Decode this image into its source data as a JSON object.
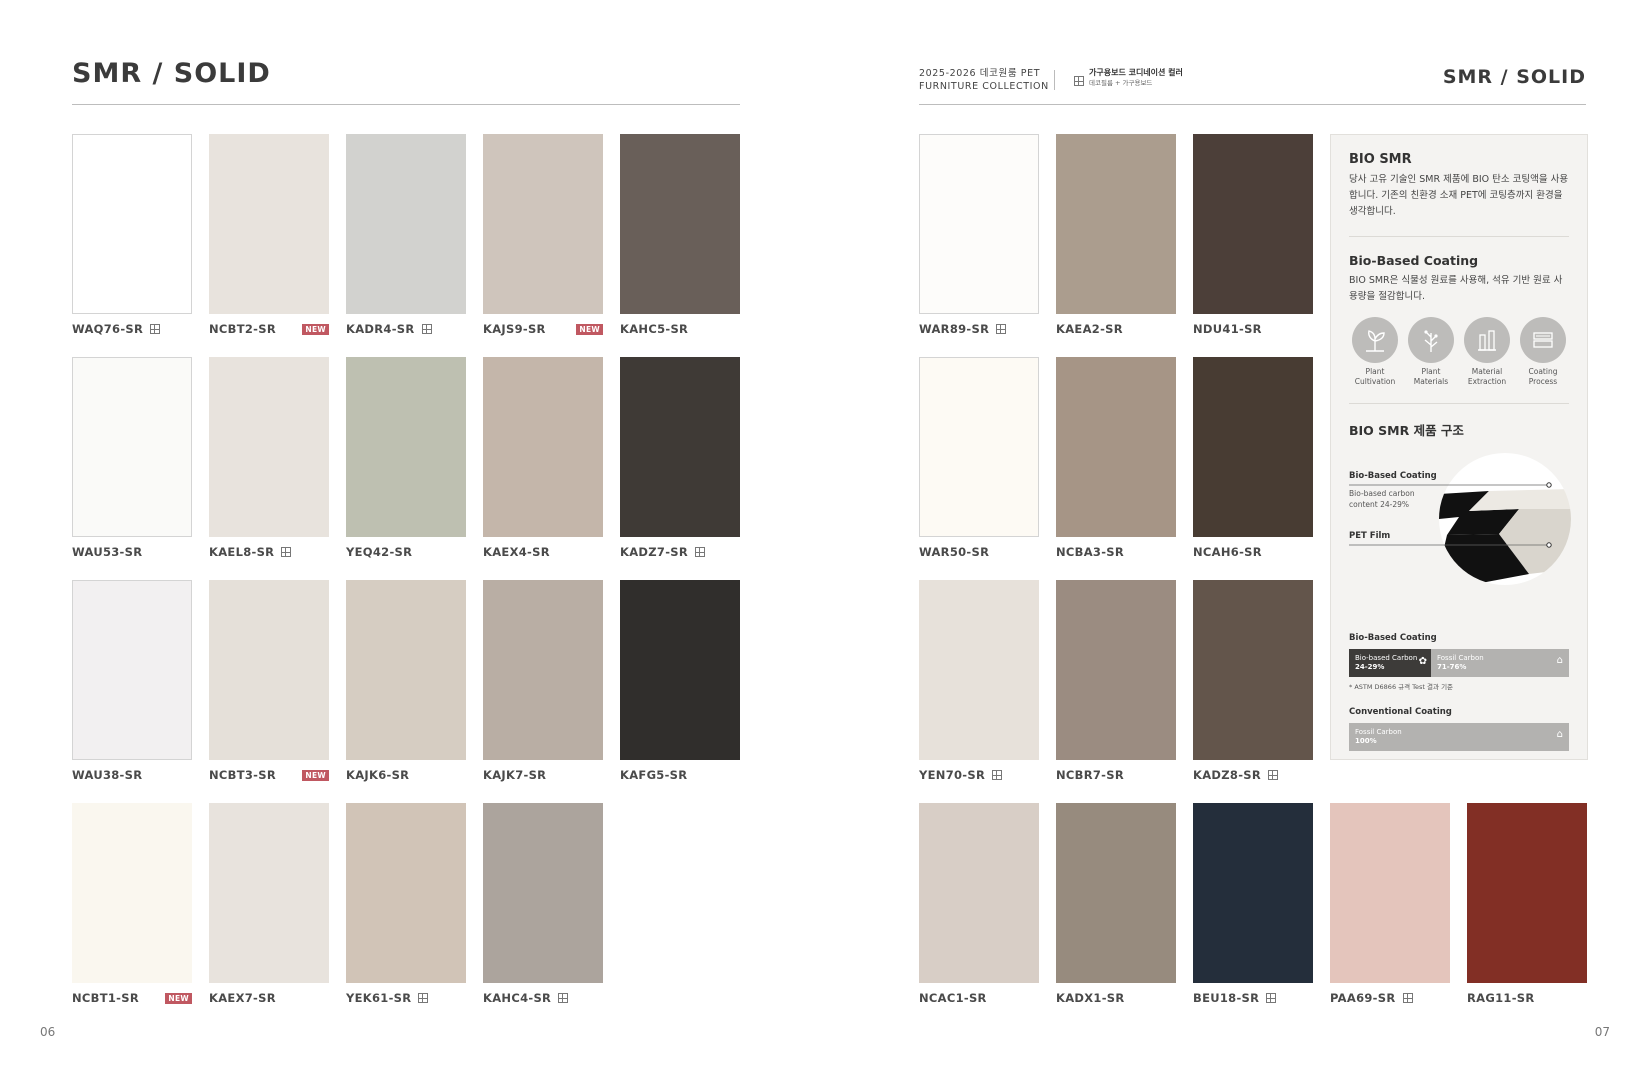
{
  "left_page": {
    "title": "SMR / SOLID",
    "page_number": "06",
    "rows": [
      [
        {
          "code": "WAQ76-SR",
          "color": "#ffffff",
          "bordered": true,
          "grid": true,
          "new": false
        },
        {
          "code": "NCBT2-SR",
          "color": "#e8e3dd",
          "bordered": false,
          "grid": false,
          "new": true
        },
        {
          "code": "KADR4-SR",
          "color": "#d2d2cf",
          "bordered": false,
          "grid": true,
          "new": false
        },
        {
          "code": "KAJS9-SR",
          "color": "#cfc5bc",
          "bordered": false,
          "grid": false,
          "new": true
        },
        {
          "code": "KAHC5-SR",
          "color": "#695f59",
          "bordered": false,
          "grid": false,
          "new": false
        }
      ],
      [
        {
          "code": "WAU53-SR",
          "color": "#fafaf8",
          "bordered": true,
          "grid": false,
          "new": false
        },
        {
          "code": "KAEL8-SR",
          "color": "#e8e3dd",
          "bordered": false,
          "grid": true,
          "new": false
        },
        {
          "code": "YEQ42-SR",
          "color": "#bec0b1",
          "bordered": false,
          "grid": false,
          "new": false
        },
        {
          "code": "KAEX4-SR",
          "color": "#c4b6aa",
          "bordered": false,
          "grid": false,
          "new": false
        },
        {
          "code": "KADZ7-SR",
          "color": "#3f3a36",
          "bordered": false,
          "grid": true,
          "new": false
        }
      ],
      [
        {
          "code": "WAU38-SR",
          "color": "#f2f0f1",
          "bordered": true,
          "grid": false,
          "new": false
        },
        {
          "code": "NCBT3-SR",
          "color": "#e5e0d9",
          "bordered": false,
          "grid": false,
          "new": true
        },
        {
          "code": "KAJK6-SR",
          "color": "#d6cdc2",
          "bordered": false,
          "grid": false,
          "new": false
        },
        {
          "code": "KAJK7-SR",
          "color": "#b9aea4",
          "bordered": false,
          "grid": false,
          "new": false
        },
        {
          "code": "KAFG5-SR",
          "color": "#302e2c",
          "bordered": false,
          "grid": false,
          "new": false
        }
      ],
      [
        {
          "code": "NCBT1-SR",
          "color": "#faf7ef",
          "bordered": false,
          "grid": false,
          "new": true
        },
        {
          "code": "KAEX7-SR",
          "color": "#e8e3dd",
          "bordered": false,
          "grid": false,
          "new": false
        },
        {
          "code": "YEK61-SR",
          "color": "#d1c4b7",
          "bordered": false,
          "grid": true,
          "new": false
        },
        {
          "code": "KAHC4-SR",
          "color": "#aca49d",
          "bordered": false,
          "grid": true,
          "new": false
        }
      ]
    ]
  },
  "right_page": {
    "title": "SMR / SOLID",
    "page_number": "07",
    "header": {
      "line1": "2025-2026 데코원룸 PET",
      "line2": "FURNITURE COLLECTION",
      "right1": "가구용보드 코디네이션 컬러",
      "right2": "데코필름 + 가구용보드"
    },
    "rows": [
      [
        {
          "code": "WAR89-SR",
          "color": "#fdfcfa",
          "bordered": true,
          "grid": true,
          "new": false
        },
        {
          "code": "KAEA2-SR",
          "color": "#ab9d8e",
          "bordered": false,
          "grid": false,
          "new": false
        },
        {
          "code": "NDU41-SR",
          "color": "#4c3f39",
          "bordered": false,
          "grid": false,
          "new": false
        }
      ],
      [
        {
          "code": "WAR50-SR",
          "color": "#fdfaf4",
          "bordered": true,
          "grid": false,
          "new": false
        },
        {
          "code": "NCBA3-SR",
          "color": "#a69586",
          "bordered": false,
          "grid": false,
          "new": false
        },
        {
          "code": "NCAH6-SR",
          "color": "#483c33",
          "bordered": false,
          "grid": false,
          "new": false
        }
      ],
      [
        {
          "code": "YEN70-SR",
          "color": "#e7e1da",
          "bordered": false,
          "grid": true,
          "new": false
        },
        {
          "code": "NCBR7-SR",
          "color": "#9b8c81",
          "bordered": false,
          "grid": false,
          "new": false
        },
        {
          "code": "KADZ8-SR",
          "color": "#63554b",
          "bordered": false,
          "grid": true,
          "new": false
        }
      ],
      [
        {
          "code": "NCAC1-SR",
          "color": "#d8cec6",
          "bordered": false,
          "grid": false,
          "new": false
        },
        {
          "code": "KADX1-SR",
          "color": "#978b7e",
          "bordered": false,
          "grid": false,
          "new": false
        },
        {
          "code": "BEU18-SR",
          "color": "#242e3b",
          "bordered": false,
          "grid": true,
          "new": false
        },
        {
          "code": "PAA69-SR",
          "color": "#e4c5bc",
          "bordered": false,
          "grid": true,
          "new": false
        },
        {
          "code": "RAG11-SR",
          "color": "#822f25",
          "bordered": false,
          "grid": false,
          "new": false
        }
      ]
    ],
    "panel": {
      "heading1": "BIO SMR",
      "text1": "당사 고유 기술인 SMR 제품에 BIO 탄소 코팅액을 사용합니다. 기존의 친환경 소재 PET에 코팅층까지 환경을 생각합니다.",
      "heading2": "Bio-Based Coating",
      "text2": "BIO SMR은 식물성 원료를 사용해, 석유 기반 원료 사용량을 절감합니다.",
      "process": [
        {
          "line1": "Plant",
          "line2": "Cultivation",
          "icon": "plant-cultivation-icon"
        },
        {
          "line1": "Plant",
          "line2": "Materials",
          "icon": "plant-materials-icon"
        },
        {
          "line1": "Material",
          "line2": "Extraction",
          "icon": "material-extraction-icon"
        },
        {
          "line1": "Coating",
          "line2": "Process",
          "icon": "coating-process-icon"
        }
      ],
      "heading3": "BIO SMR 제품 구조",
      "layer1_title": "Bio-Based Coating",
      "layer1_sub1": "Bio-based carbon",
      "layer1_sub2": "content 24-29%",
      "layer2_title": "PET Film",
      "bar1_title": "Bio-Based Coating",
      "bar1_seg1_a": "Bio-based Carbon",
      "bar1_seg1_b": "24-29%",
      "bar1_seg2_a": "Fossil Carbon",
      "bar1_seg2_b": "71-76%",
      "bar1_note": "* ASTM D6866 규격 Test 결과 기준",
      "bar2_title": "Conventional Coating",
      "bar2_seg_a": "Fossil Carbon",
      "bar2_seg_b": "100%",
      "bar_colors": {
        "bio": "#3d3b39",
        "fossil": "#b3b2b0"
      }
    }
  }
}
